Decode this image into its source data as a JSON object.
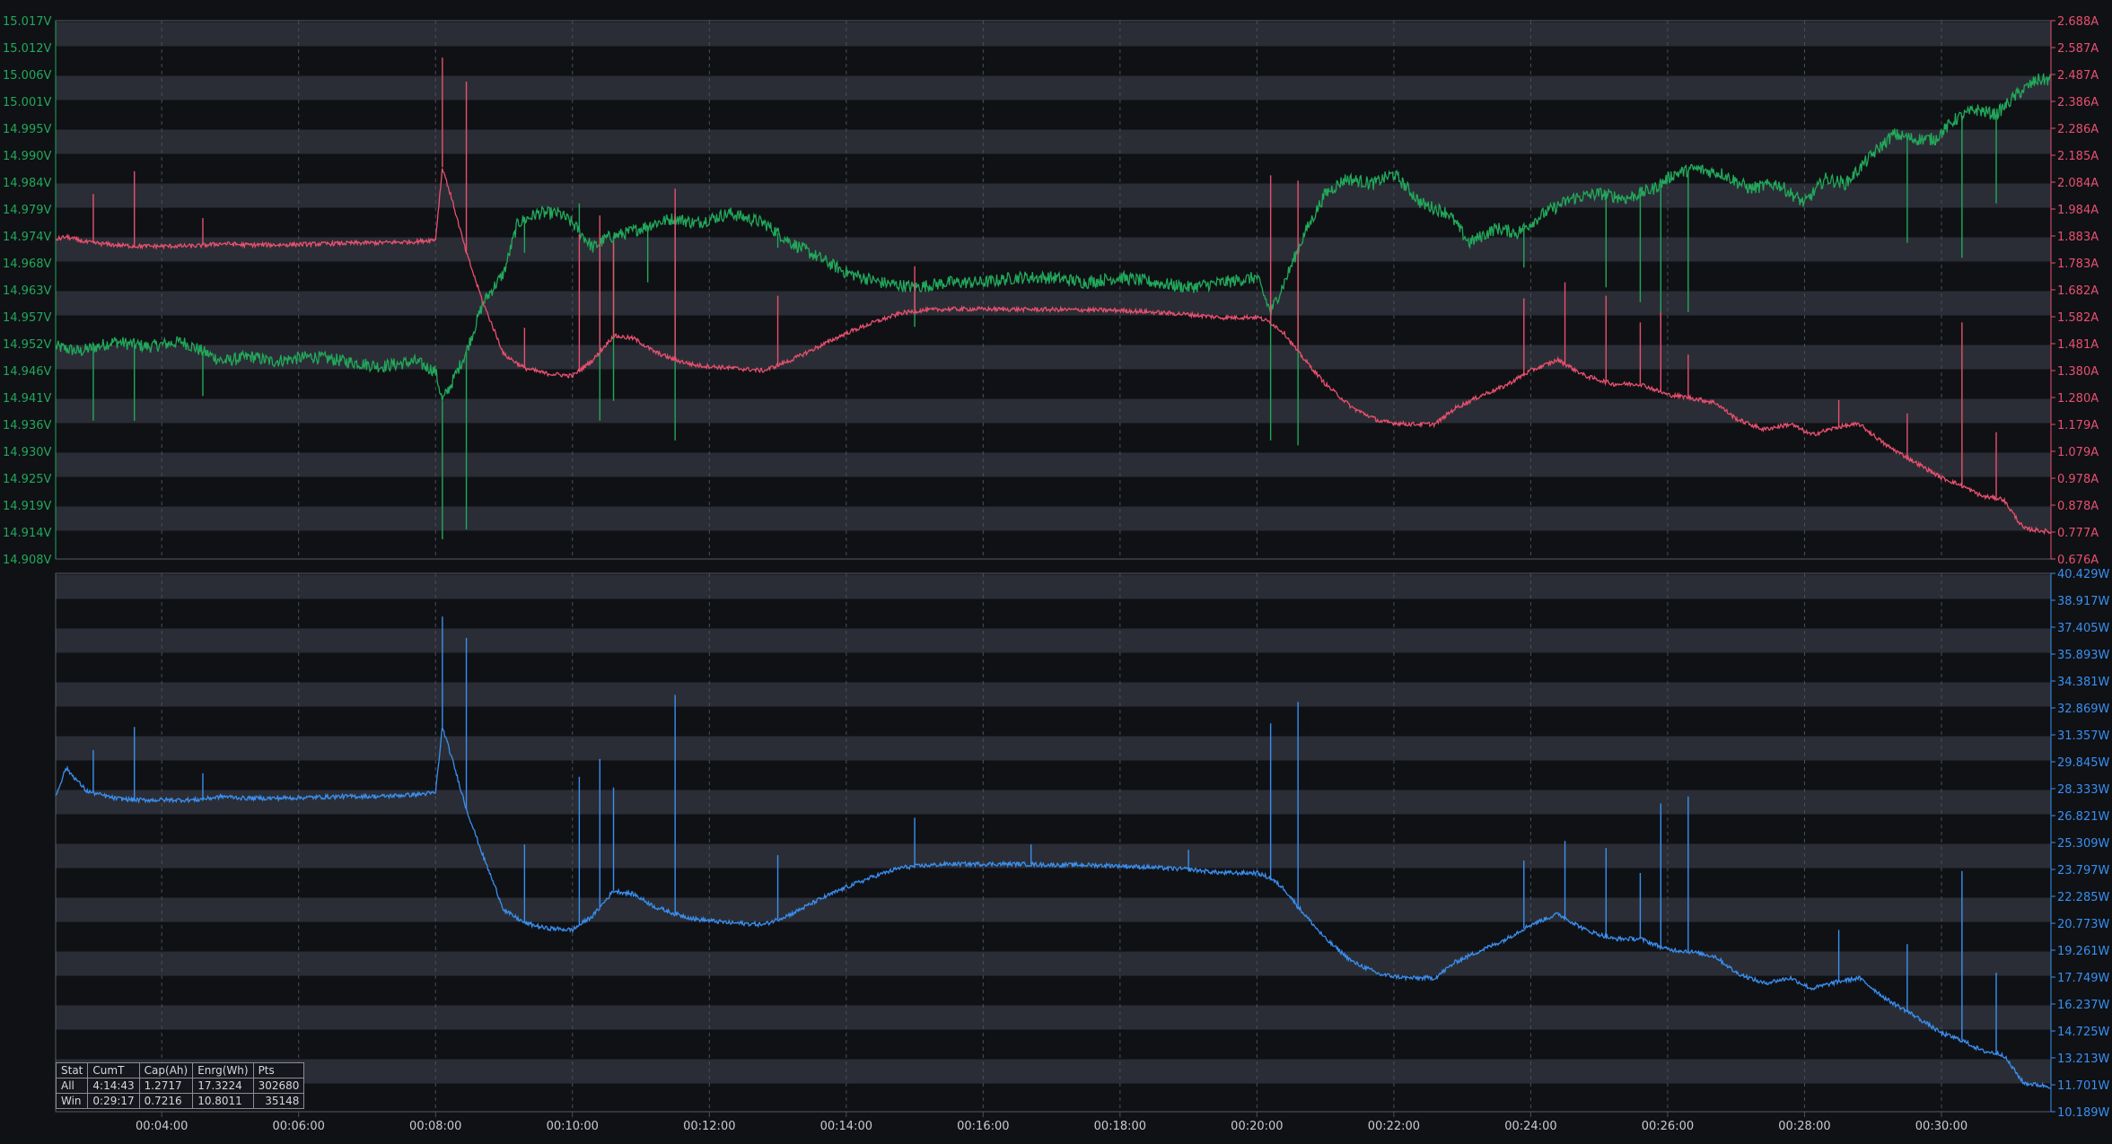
{
  "colors": {
    "background": "#0f1115",
    "band": "#2a2d35",
    "voltage": "#22a85a",
    "current": "#e8506e",
    "power": "#3a8ff0",
    "grid": "#4a4e57",
    "time_label": "#c8cad0"
  },
  "chart_data": [
    {
      "type": "line",
      "title": "",
      "grid": true,
      "x_ticks": [
        "00:04:00",
        "00:06:00",
        "00:08:00",
        "00:10:00",
        "00:12:00",
        "00:14:00",
        "00:16:00",
        "00:18:00",
        "00:20:00",
        "00:22:00",
        "00:24:00",
        "00:26:00",
        "00:28:00",
        "00:30:00"
      ],
      "x_tick_minutes": [
        4,
        6,
        8,
        10,
        12,
        14,
        16,
        18,
        20,
        22,
        24,
        26,
        28,
        30
      ],
      "xlim_minutes": [
        2.45,
        31.6
      ],
      "y_left": {
        "ylim": [
          14.908,
          15.017
        ],
        "ticks": [
          "15.017V",
          "15.012V",
          "15.006V",
          "15.001V",
          "14.995V",
          "14.990V",
          "14.984V",
          "14.979V",
          "14.974V",
          "14.968V",
          "14.963V",
          "14.957V",
          "14.952V",
          "14.946V",
          "14.941V",
          "14.936V",
          "14.930V",
          "14.925V",
          "14.919V",
          "14.914V",
          "14.908V"
        ]
      },
      "y_right": {
        "ylim": [
          0.676,
          2.688
        ],
        "ticks": [
          "2.688A",
          "2.587A",
          "2.487A",
          "2.386A",
          "2.286A",
          "2.185A",
          "2.084A",
          "1.984A",
          "1.883A",
          "1.783A",
          "1.682A",
          "1.582A",
          "1.481A",
          "1.380A",
          "1.280A",
          "1.179A",
          "1.079A",
          "0.978A",
          "0.878A",
          "0.777A",
          "0.676A"
        ]
      },
      "series": [
        {
          "axis": "left",
          "x": [
            2.45,
            2.8,
            3.3,
            3.8,
            4.3,
            4.9,
            5.3,
            5.6,
            6.2,
            6.7,
            7.2,
            7.7,
            8.0,
            8.1,
            8.25,
            8.45,
            8.7,
            9.0,
            9.2,
            9.5,
            9.8,
            10.0,
            10.3,
            10.5,
            10.8,
            11.2,
            11.5,
            11.8,
            12.3,
            12.8,
            13.2,
            13.6,
            14.0,
            14.5,
            15.0,
            15.5,
            16.0,
            16.5,
            17.0,
            17.5,
            18.0,
            18.5,
            19.0,
            19.5,
            20.0,
            20.2,
            20.4,
            20.7,
            21.0,
            21.3,
            21.7,
            22.0,
            22.4,
            22.8,
            23.1,
            23.5,
            23.8,
            24.2,
            24.6,
            25.0,
            25.4,
            25.8,
            26.1,
            26.4,
            26.8,
            27.2,
            27.6,
            28.0,
            28.3,
            28.6,
            29.0,
            29.3,
            29.6,
            29.9,
            30.2,
            30.5,
            30.8,
            31.1,
            31.4,
            31.6
          ],
          "y": [
            14.951,
            14.95,
            14.952,
            14.951,
            14.952,
            14.948,
            14.949,
            14.948,
            14.949,
            14.948,
            14.947,
            14.948,
            14.946,
            14.94,
            14.944,
            14.95,
            14.96,
            14.966,
            14.976,
            14.978,
            14.978,
            14.976,
            14.971,
            14.973,
            14.974,
            14.976,
            14.977,
            14.976,
            14.978,
            14.976,
            14.972,
            14.969,
            14.966,
            14.964,
            14.963,
            14.964,
            14.964,
            14.965,
            14.965,
            14.964,
            14.965,
            14.964,
            14.963,
            14.964,
            14.965,
            14.958,
            14.964,
            14.974,
            14.982,
            14.985,
            14.984,
            14.986,
            14.98,
            14.978,
            14.972,
            14.975,
            14.974,
            14.978,
            14.981,
            14.982,
            14.981,
            14.983,
            14.986,
            14.987,
            14.986,
            14.983,
            14.984,
            14.98,
            14.985,
            14.984,
            14.99,
            14.994,
            14.993,
            14.993,
            14.997,
            14.999,
            14.998,
            15.002,
            15.005,
            15.005
          ],
          "spikes": [
            [
              3.0,
              14.936
            ],
            [
              3.6,
              14.936
            ],
            [
              4.6,
              14.941
            ],
            [
              8.1,
              14.912
            ],
            [
              8.45,
              14.914
            ],
            [
              9.3,
              14.97
            ],
            [
              10.1,
              14.98
            ],
            [
              10.4,
              14.936
            ],
            [
              10.6,
              14.94
            ],
            [
              11.1,
              14.964
            ],
            [
              11.5,
              14.932
            ],
            [
              13.0,
              14.971
            ],
            [
              15.0,
              14.955
            ],
            [
              20.2,
              14.932
            ],
            [
              20.6,
              14.931
            ],
            [
              23.9,
              14.967
            ],
            [
              24.5,
              14.98
            ],
            [
              25.1,
              14.963
            ],
            [
              25.6,
              14.96
            ],
            [
              25.9,
              14.955
            ],
            [
              26.3,
              14.958
            ],
            [
              29.5,
              14.972
            ],
            [
              30.3,
              14.969
            ],
            [
              30.8,
              14.98
            ]
          ]
        },
        {
          "axis": "right",
          "x": [
            2.45,
            2.6,
            2.9,
            3.3,
            3.6,
            4.0,
            4.5,
            4.9,
            5.2,
            5.7,
            6.2,
            6.7,
            7.2,
            7.7,
            8.0,
            8.1,
            8.25,
            8.45,
            8.7,
            9.0,
            9.3,
            9.6,
            10.0,
            10.3,
            10.6,
            10.9,
            11.2,
            11.5,
            11.8,
            12.3,
            12.8,
            13.2,
            13.6,
            14.0,
            14.4,
            14.8,
            15.1,
            15.5,
            16.0,
            16.5,
            17.0,
            17.5,
            18.0,
            18.5,
            19.0,
            19.5,
            20.0,
            20.2,
            20.4,
            20.6,
            21.0,
            21.4,
            21.8,
            22.2,
            22.6,
            22.9,
            23.3,
            23.6,
            24.0,
            24.4,
            24.8,
            25.2,
            25.6,
            26.0,
            26.3,
            26.7,
            27.0,
            27.4,
            27.8,
            28.1,
            28.5,
            28.8,
            29.2,
            29.6,
            30.0,
            30.3,
            30.6,
            30.9,
            31.2,
            31.6
          ],
          "y": [
            1.87,
            1.88,
            1.86,
            1.85,
            1.845,
            1.845,
            1.846,
            1.855,
            1.85,
            1.85,
            1.853,
            1.856,
            1.858,
            1.862,
            1.87,
            2.14,
            2.01,
            1.82,
            1.63,
            1.44,
            1.39,
            1.37,
            1.36,
            1.42,
            1.51,
            1.5,
            1.45,
            1.42,
            1.4,
            1.39,
            1.38,
            1.42,
            1.47,
            1.52,
            1.56,
            1.595,
            1.605,
            1.61,
            1.61,
            1.609,
            1.608,
            1.607,
            1.605,
            1.598,
            1.59,
            1.578,
            1.58,
            1.56,
            1.52,
            1.45,
            1.33,
            1.24,
            1.19,
            1.18,
            1.18,
            1.24,
            1.29,
            1.32,
            1.38,
            1.42,
            1.36,
            1.33,
            1.33,
            1.29,
            1.28,
            1.26,
            1.2,
            1.16,
            1.18,
            1.14,
            1.17,
            1.18,
            1.1,
            1.04,
            0.98,
            0.95,
            0.91,
            0.9,
            0.79,
            0.777
          ],
          "spikes": [
            [
              3.0,
              2.04
            ],
            [
              3.6,
              2.125
            ],
            [
              4.6,
              1.95
            ],
            [
              8.1,
              2.55
            ],
            [
              8.45,
              2.46
            ],
            [
              9.3,
              1.54
            ],
            [
              10.1,
              1.89
            ],
            [
              10.4,
              1.96
            ],
            [
              10.6,
              1.86
            ],
            [
              11.5,
              2.06
            ],
            [
              13.0,
              1.66
            ],
            [
              15.0,
              1.77
            ],
            [
              20.2,
              2.11
            ],
            [
              20.6,
              2.09
            ],
            [
              23.9,
              1.65
            ],
            [
              24.5,
              1.71
            ],
            [
              25.1,
              1.66
            ],
            [
              25.6,
              1.56
            ],
            [
              25.9,
              1.6
            ],
            [
              26.3,
              1.44
            ],
            [
              28.5,
              1.27
            ],
            [
              29.5,
              1.22
            ],
            [
              30.3,
              1.56
            ],
            [
              30.8,
              1.15
            ]
          ]
        }
      ]
    },
    {
      "type": "line",
      "title": "",
      "grid": true,
      "x_ticks": [
        "00:04:00",
        "00:06:00",
        "00:08:00",
        "00:10:00",
        "00:12:00",
        "00:14:00",
        "00:16:00",
        "00:18:00",
        "00:20:00",
        "00:22:00",
        "00:24:00",
        "00:26:00",
        "00:28:00",
        "00:30:00"
      ],
      "xlim_minutes": [
        2.45,
        31.6
      ],
      "y_right": {
        "ylim": [
          10.189,
          40.429
        ],
        "ticks": [
          "40.429W",
          "38.917W",
          "37.405W",
          "35.893W",
          "34.381W",
          "32.869W",
          "31.357W",
          "29.845W",
          "28.333W",
          "26.821W",
          "25.309W",
          "23.797W",
          "22.285W",
          "20.773W",
          "19.261W",
          "17.749W",
          "16.237W",
          "14.725W",
          "13.213W",
          "11.701W",
          "10.189W"
        ]
      },
      "series": [
        {
          "axis": "right",
          "x": [
            2.45,
            2.6,
            2.9,
            3.3,
            3.6,
            4.0,
            4.5,
            4.9,
            5.2,
            5.7,
            6.2,
            6.7,
            7.2,
            7.7,
            8.0,
            8.1,
            8.25,
            8.45,
            8.7,
            9.0,
            9.3,
            9.6,
            10.0,
            10.3,
            10.6,
            10.9,
            11.2,
            11.5,
            11.8,
            12.3,
            12.8,
            13.2,
            13.6,
            14.0,
            14.4,
            14.8,
            15.1,
            15.5,
            16.0,
            16.5,
            17.0,
            17.5,
            18.0,
            18.5,
            19.0,
            19.5,
            20.0,
            20.2,
            20.4,
            20.6,
            21.0,
            21.4,
            21.8,
            22.2,
            22.6,
            22.9,
            23.3,
            23.6,
            24.0,
            24.4,
            24.8,
            25.2,
            25.6,
            26.0,
            26.3,
            26.7,
            27.0,
            27.4,
            27.8,
            28.1,
            28.5,
            28.8,
            29.2,
            29.6,
            30.0,
            30.3,
            30.6,
            30.9,
            31.2,
            31.6
          ],
          "y": [
            27.9,
            29.5,
            28.2,
            27.8,
            27.7,
            27.7,
            27.7,
            27.9,
            27.8,
            27.8,
            27.85,
            27.9,
            27.9,
            28.0,
            28.1,
            31.8,
            29.9,
            27.2,
            24.5,
            21.5,
            20.8,
            20.5,
            20.4,
            21.2,
            22.6,
            22.4,
            21.7,
            21.3,
            21.0,
            20.8,
            20.7,
            21.3,
            22.1,
            22.8,
            23.4,
            23.9,
            24.0,
            24.1,
            24.1,
            24.1,
            24.05,
            24.05,
            24.0,
            23.9,
            23.8,
            23.6,
            23.6,
            23.3,
            22.7,
            21.7,
            19.9,
            18.6,
            17.9,
            17.7,
            17.7,
            18.6,
            19.3,
            19.8,
            20.7,
            21.3,
            20.4,
            19.9,
            19.9,
            19.3,
            19.2,
            18.9,
            18.0,
            17.4,
            17.7,
            17.1,
            17.5,
            17.7,
            16.5,
            15.6,
            14.6,
            14.2,
            13.6,
            13.4,
            11.8,
            11.6
          ],
          "spikes": [
            [
              3.0,
              30.5
            ],
            [
              3.6,
              31.8
            ],
            [
              4.6,
              29.2
            ],
            [
              8.1,
              38.0
            ],
            [
              8.45,
              36.8
            ],
            [
              9.3,
              25.2
            ],
            [
              10.1,
              29.0
            ],
            [
              10.4,
              30.0
            ],
            [
              10.6,
              28.4
            ],
            [
              11.5,
              33.6
            ],
            [
              13.0,
              24.6
            ],
            [
              15.0,
              26.7
            ],
            [
              16.7,
              25.2
            ],
            [
              19.0,
              24.9
            ],
            [
              20.2,
              32.0
            ],
            [
              20.6,
              33.2
            ],
            [
              23.9,
              24.3
            ],
            [
              24.5,
              25.4
            ],
            [
              25.1,
              25.0
            ],
            [
              25.6,
              23.6
            ],
            [
              25.9,
              27.5
            ],
            [
              26.3,
              27.9
            ],
            [
              28.5,
              20.4
            ],
            [
              29.5,
              19.6
            ],
            [
              30.3,
              23.7
            ],
            [
              30.8,
              18.0
            ]
          ]
        }
      ]
    }
  ],
  "stats": {
    "headers": [
      "Stat",
      "CumT",
      "Cap(Ah)",
      "Enrg(Wh)",
      "Pts"
    ],
    "rows": [
      [
        "All",
        "4:14:43",
        "1.2717",
        "17.3224",
        "302680"
      ],
      [
        "Win",
        "0:29:17",
        "0.7216",
        "10.8011",
        "35148"
      ]
    ]
  }
}
